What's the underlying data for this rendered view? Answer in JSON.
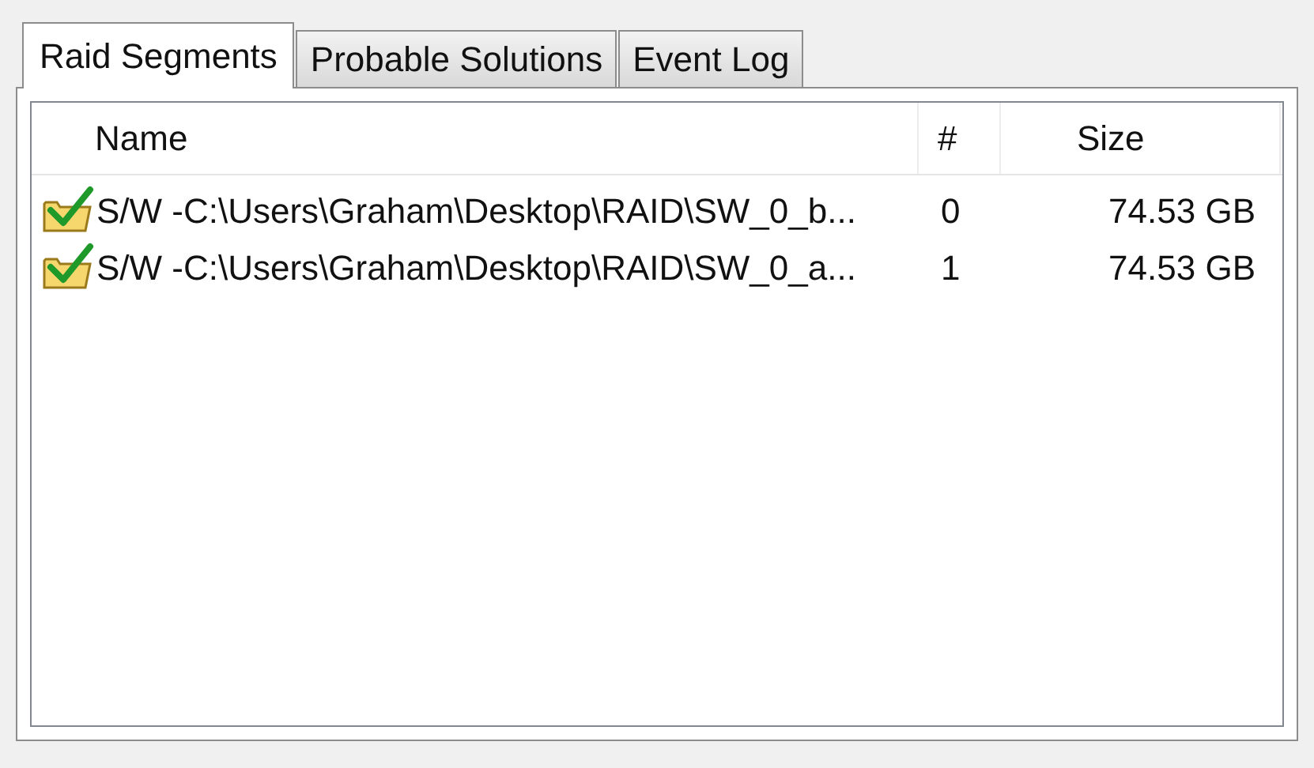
{
  "tabs": [
    {
      "label": "Raid Segments",
      "selected": true
    },
    {
      "label": "Probable Solutions",
      "selected": false
    },
    {
      "label": "Event Log",
      "selected": false
    }
  ],
  "table": {
    "columns": [
      "Name",
      "#",
      "Size"
    ],
    "rows": [
      {
        "name": "S/W -C:\\Users\\Graham\\Desktop\\RAID\\SW_0_b...",
        "number": "0",
        "size": "74.53 GB"
      },
      {
        "name": "S/W -C:\\Users\\Graham\\Desktop\\RAID\\SW_0_a...",
        "number": "1",
        "size": "74.53 GB"
      }
    ]
  }
}
